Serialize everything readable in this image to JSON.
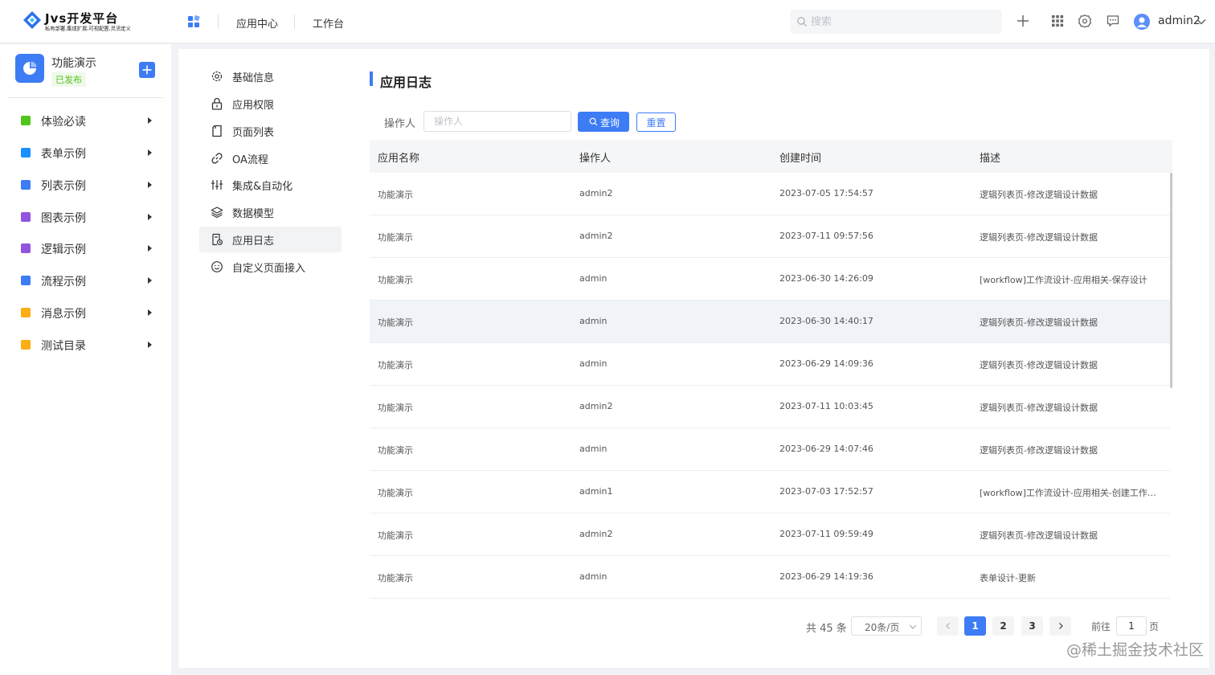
{
  "header": {
    "logo_title": "Jvs开发平台",
    "logo_subtitle": "私有部署,集成扩展,可视配置,灵活定义",
    "nav": [
      "应用中心",
      "工作台"
    ],
    "search_placeholder": "搜索",
    "user_name": "admin2",
    "brand_color": "#3d7cf5"
  },
  "sidebar": {
    "app_name": "功能演示",
    "app_status": "已发布",
    "items": [
      {
        "label": "体验必读",
        "color": "#52c41a"
      },
      {
        "label": "表单示例",
        "color": "#1890ff"
      },
      {
        "label": "列表示例",
        "color": "#3d7cf5"
      },
      {
        "label": "图表示例",
        "color": "#9254de"
      },
      {
        "label": "逻辑示例",
        "color": "#9254de"
      },
      {
        "label": "流程示例",
        "color": "#3d7cf5"
      },
      {
        "label": "消息示例",
        "color": "#faad14"
      },
      {
        "label": "测试目录",
        "color": "#faad14"
      }
    ]
  },
  "subnav": {
    "items": [
      {
        "label": "基础信息",
        "icon": "gear-icon"
      },
      {
        "label": "应用权限",
        "icon": "lock-icon"
      },
      {
        "label": "页面列表",
        "icon": "page-icon"
      },
      {
        "label": "OA流程",
        "icon": "link-icon"
      },
      {
        "label": "集成&自动化",
        "icon": "sliders-icon"
      },
      {
        "label": "数据模型",
        "icon": "layers-icon"
      },
      {
        "label": "应用日志",
        "icon": "log-icon"
      },
      {
        "label": "自定义页面接入",
        "icon": "smile-icon"
      }
    ],
    "active_index": 6
  },
  "content": {
    "title": "应用日志",
    "filter_label": "操作人",
    "filter_placeholder": "操作人",
    "query_label": "查询",
    "reset_label": "重置"
  },
  "table": {
    "columns": [
      "应用名称",
      "操作人",
      "创建时间",
      "描述"
    ],
    "rows": [
      [
        "功能演示",
        "admin2",
        "2023-07-05 17:54:57",
        "逻辑列表页-修改逻辑设计数据"
      ],
      [
        "功能演示",
        "admin2",
        "2023-07-11 09:57:56",
        "逻辑列表页-修改逻辑设计数据"
      ],
      [
        "功能演示",
        "admin",
        "2023-06-30 14:26:09",
        "[workflow]工作流设计-应用相关-保存设计"
      ],
      [
        "功能演示",
        "admin",
        "2023-06-30 14:40:17",
        "逻辑列表页-修改逻辑设计数据"
      ],
      [
        "功能演示",
        "admin",
        "2023-06-29 14:09:36",
        "逻辑列表页-修改逻辑设计数据"
      ],
      [
        "功能演示",
        "admin2",
        "2023-07-11 10:03:45",
        "逻辑列表页-修改逻辑设计数据"
      ],
      [
        "功能演示",
        "admin",
        "2023-06-29 14:07:46",
        "逻辑列表页-修改逻辑设计数据"
      ],
      [
        "功能演示",
        "admin1",
        "2023-07-03 17:52:57",
        "[workflow]工作流设计-应用相关-创建工作流列表"
      ],
      [
        "功能演示",
        "admin2",
        "2023-07-11 09:59:49",
        "逻辑列表页-修改逻辑设计数据"
      ],
      [
        "功能演示",
        "admin",
        "2023-06-29 14:19:36",
        "表单设计-更新"
      ]
    ],
    "hover_row": 3
  },
  "pagination": {
    "total": "共 45 条",
    "page_size": "20条/页",
    "pages": [
      "1",
      "2",
      "3"
    ],
    "current": "1",
    "goto_label": "前往",
    "goto_value": "1",
    "page_suffix": "页"
  },
  "footer": {
    "watermark": "@稀土掘金技术社区"
  }
}
